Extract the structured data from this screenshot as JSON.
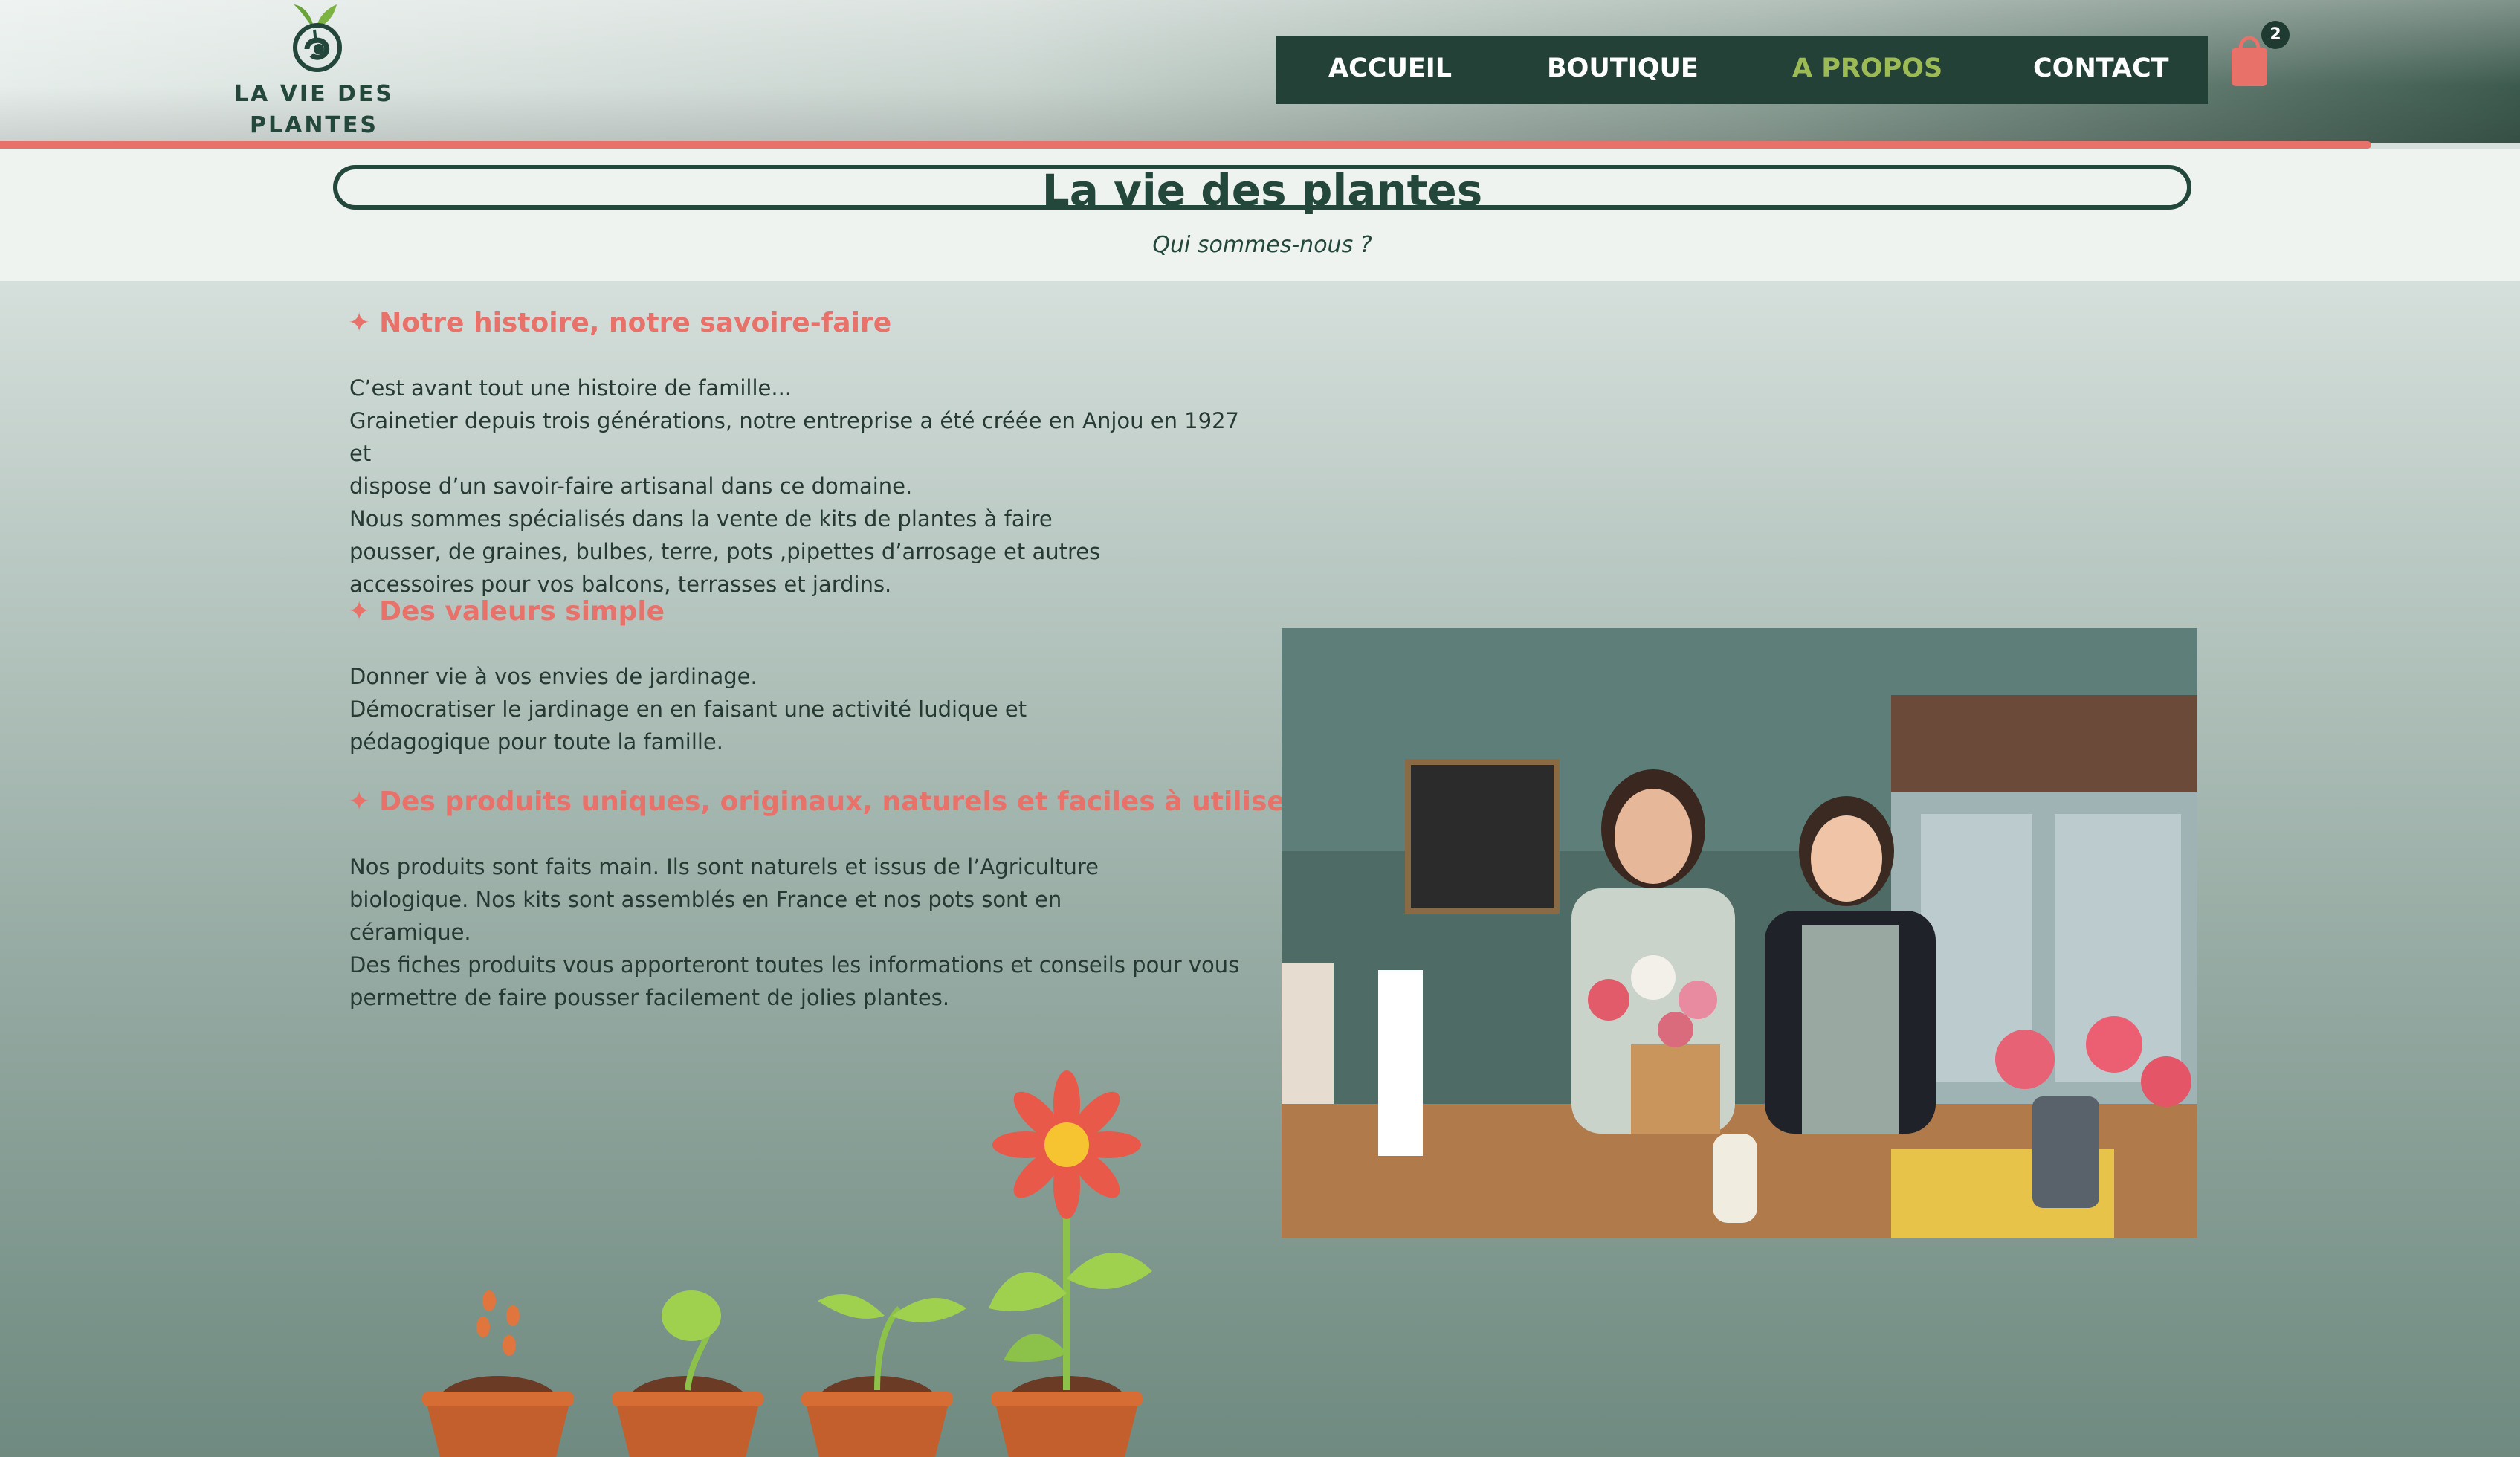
{
  "brand": {
    "name_line1": "LA VIE DES",
    "name_line2": "PLANTES",
    "logo_icon": "sprout-spiral-icon",
    "colors": {
      "primary": "#24473b",
      "accent": "#e8716a",
      "active_nav": "#9dbb55"
    }
  },
  "nav": {
    "items": [
      {
        "label": "ACCUEIL",
        "active": false
      },
      {
        "label": "BOUTIQUE",
        "active": false
      },
      {
        "label": "A PROPOS",
        "active": true
      },
      {
        "label": "CONTACT",
        "active": false
      }
    ]
  },
  "cart": {
    "icon": "shopping-bag-icon",
    "count": "2"
  },
  "page": {
    "title": "La vie des plantes",
    "subtitle": "Qui sommes-nous ?"
  },
  "sections": [
    {
      "star": "✦",
      "heading": "Notre histoire, notre savoire-faire",
      "text": "C’est avant tout une histoire de famille...\nGrainetier depuis trois générations, notre entreprise a été créée en Anjou en 1927 et\ndispose d’un savoir-faire artisanal dans ce domaine.\nNous sommes spécialisés dans la vente de kits de plantes à faire\npousser, de graines, bulbes, terre, pots ,pipettes d’arrosage et autres\naccessoires pour vos balcons, terrasses et jardins."
    },
    {
      "star": "✦",
      "heading": "Des valeurs simple",
      "text": "Donner vie à vos envies de jardinage.\nDémocratiser le jardinage en en faisant une activité ludique et\npédagogique pour toute la famille."
    },
    {
      "star": "✦",
      "heading": "Des produits uniques, originaux, naturels et faciles à utiliser",
      "text": "Nos produits sont faits main. Ils sont naturels et issus de l’Agriculture\nbiologique. Nos kits sont assemblés en France et nos pots sont en\ncéramique.\nDes fiches produits vous apporteront toutes les informations et conseils pour vous\npermettre de faire pousser facilement de jolies plantes."
    }
  ],
  "illustrations": {
    "photo": "florists-shop-photo",
    "growth": "plant-growth-stages-illustration"
  }
}
